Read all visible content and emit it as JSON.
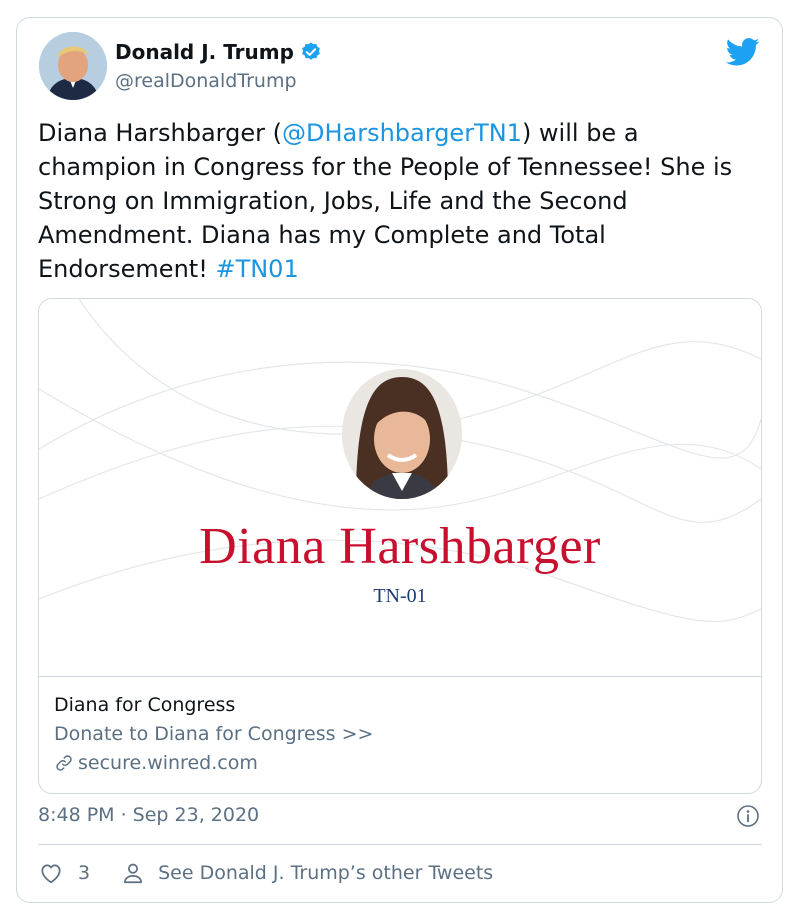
{
  "author": {
    "display_name": "Donald J. Trump",
    "handle": "@realDonaldTrump",
    "verified": true
  },
  "tweet": {
    "text_parts": [
      {
        "text": "Diana Harshbarger (",
        "type": "text"
      },
      {
        "text": "@DHarshbargerTN1",
        "type": "mention"
      },
      {
        "text": ") will be a champion in Congress for the People of Tennessee! She is Strong on Immigration, Jobs, Life and the Second Amendment. Diana has my Complete and Total Endorsement! ",
        "type": "text"
      },
      {
        "text": "#TN01",
        "type": "hashtag"
      }
    ]
  },
  "card": {
    "image_headline": "Diana Harshbarger",
    "image_subtitle": "TN-01",
    "title": "Diana for Congress",
    "description": "Donate to Diana for Congress >>",
    "domain": "secure.winred.com"
  },
  "timestamp": "8:48 PM · Sep 23, 2020",
  "actions": {
    "like_count": "3",
    "other_tweets_label": "See Donald J. Trump’s other Tweets"
  },
  "colors": {
    "link": "#1b95e0",
    "twitter_blue": "#1da1f2",
    "headline_red": "#c8102e",
    "subtitle_navy": "#1f3a6e",
    "secondary_text": "#5b7083"
  },
  "icons": {
    "brand": "twitter-bird-icon",
    "verified": "verified-badge-icon",
    "link": "link-icon",
    "info": "info-icon",
    "like": "heart-icon",
    "profile": "person-icon"
  }
}
